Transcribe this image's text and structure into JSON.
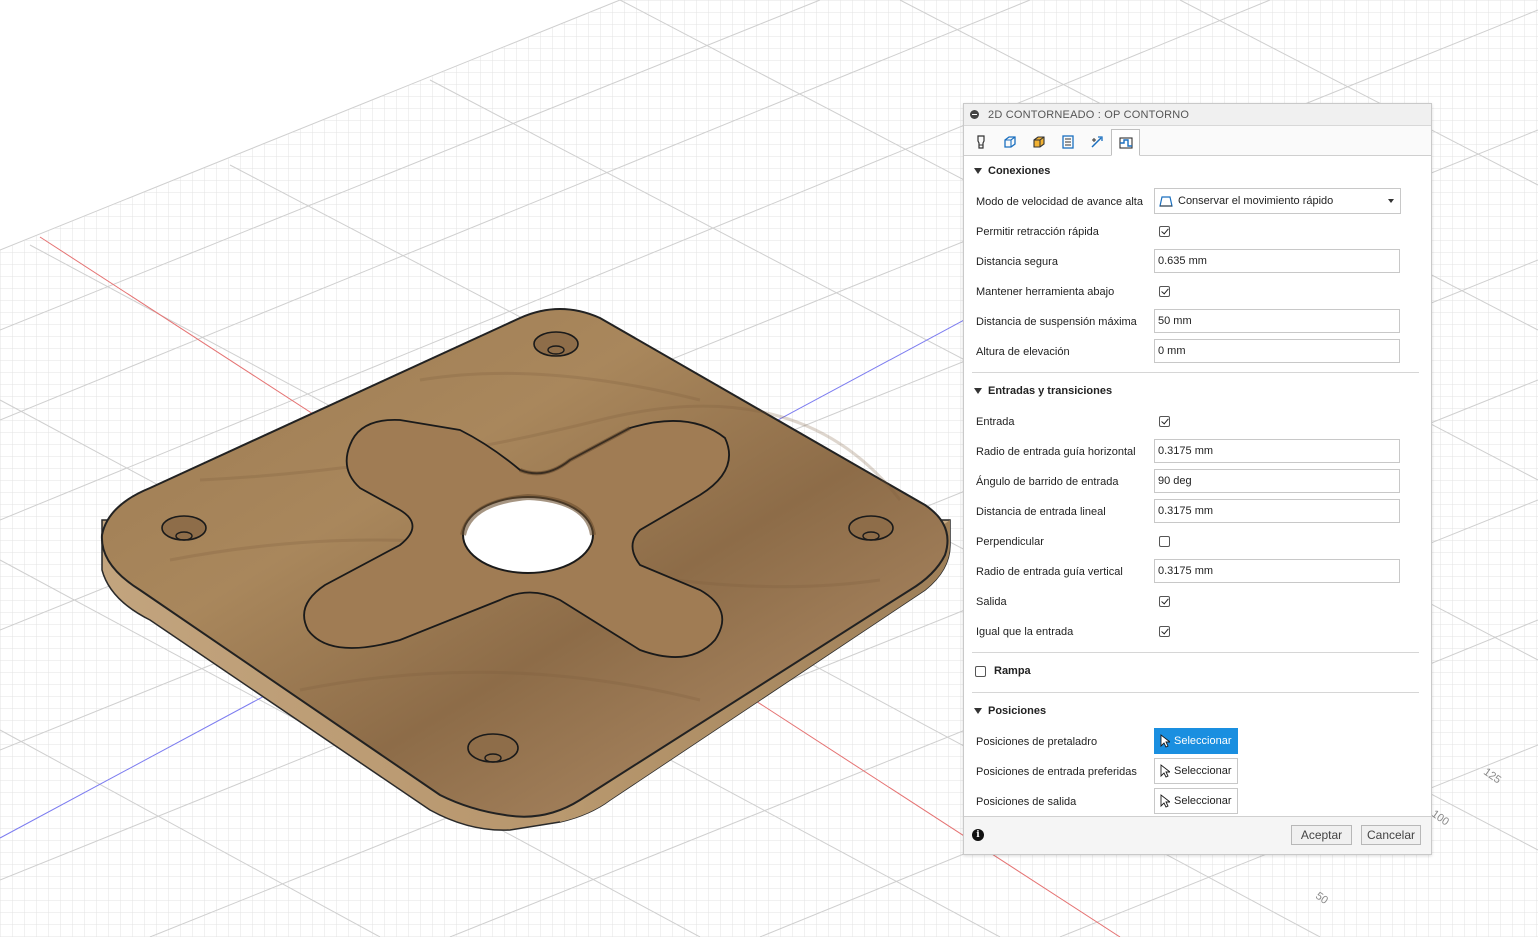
{
  "dialog": {
    "title": "2D CONTORNEADO : OP CONTORNO",
    "tabs": [
      {
        "icon": "tool-icon"
      },
      {
        "icon": "geometry-icon"
      },
      {
        "icon": "heights-icon"
      },
      {
        "icon": "passes-icon"
      },
      {
        "icon": "linking-icon",
        "active": false
      },
      {
        "icon": "linking-active-icon",
        "active": true
      }
    ],
    "sections": {
      "conexiones": {
        "title": "Conexiones",
        "modo_label": "Modo de velocidad de avance alta",
        "modo_value": "Conservar el movimiento rápido",
        "permitir_label": "Permitir retracción rápida",
        "permitir_checked": true,
        "distancia_segura_label": "Distancia segura",
        "distancia_segura_value": "0.635 mm",
        "mantener_label": "Mantener herramienta abajo",
        "mantener_checked": true,
        "suspension_label": "Distancia de suspensión máxima",
        "suspension_value": "50 mm",
        "altura_label": "Altura de elevación",
        "altura_value": "0 mm"
      },
      "entradas": {
        "title": "Entradas y transiciones",
        "entrada_label": "Entrada",
        "entrada_checked": true,
        "radio_h_label": "Radio de entrada guía horizontal",
        "radio_h_value": "0.3175 mm",
        "angulo_label": "Ángulo de barrido de entrada",
        "angulo_value": "90 deg",
        "dist_lineal_label": "Distancia de entrada lineal",
        "dist_lineal_value": "0.3175 mm",
        "perpendicular_label": "Perpendicular",
        "perpendicular_checked": false,
        "radio_v_label": "Radio de entrada guía vertical",
        "radio_v_value": "0.3175 mm",
        "salida_label": "Salida",
        "salida_checked": true,
        "igual_label": "Igual que la entrada",
        "igual_checked": true
      },
      "rampa": {
        "title": "Rampa",
        "checked": false
      },
      "posiciones": {
        "title": "Posiciones",
        "pretaladro_label": "Posiciones de pretaladro",
        "entrada_pref_label": "Posiciones de entrada preferidas",
        "salida_label": "Posiciones de salida",
        "select_label": "Seleccionar"
      }
    },
    "footer": {
      "ok_label": "Aceptar",
      "cancel_label": "Cancelar"
    }
  },
  "viewport": {
    "axis_labels": [
      "125",
      "100",
      "50"
    ],
    "material": "wood",
    "colors": {
      "grid": "#d9d9d9",
      "x_axis": "#e06060",
      "y_axis": "#6a6ae0",
      "wood": "#a07b52",
      "primary_button": "#1a8fe0"
    }
  }
}
